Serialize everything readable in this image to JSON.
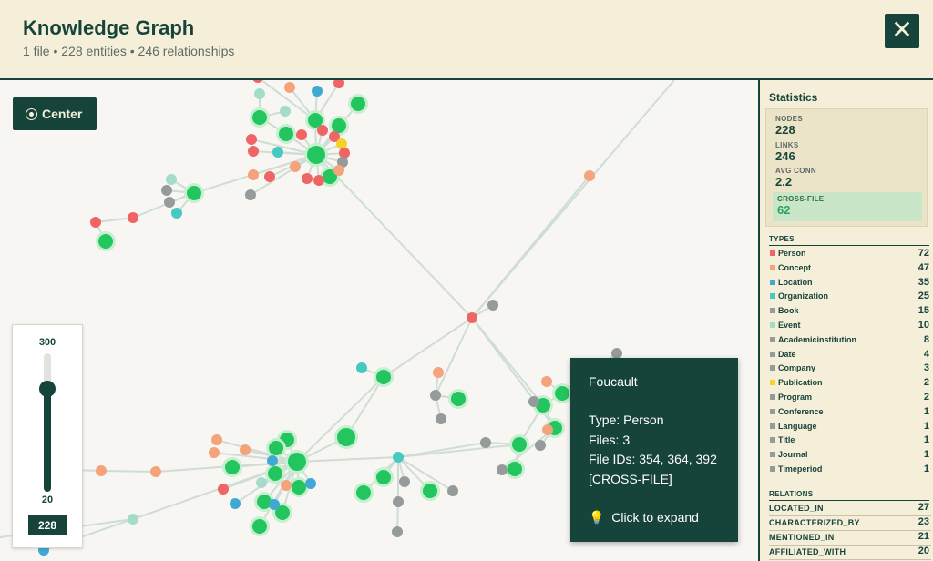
{
  "header": {
    "title": "Knowledge Graph",
    "subtitle": "1 file • 228 entities • 246 relationships",
    "close_icon": "close-icon",
    "close_glyph": "✕"
  },
  "toolbar": {
    "center_label": "Center",
    "center_icon": "target-icon"
  },
  "slider": {
    "max_label": "300",
    "min_label": "20",
    "value": "228",
    "max": 300,
    "min": 20,
    "current": 228
  },
  "tooltip": {
    "name": "Foucault",
    "type_line": "Type: Person",
    "files_line": "Files: 3",
    "ids_line": "File IDs: 354, 364, 392",
    "flag": "[CROSS-FILE]",
    "action_icon": "lightbulb-icon",
    "action_glyph": "💡",
    "action_label": "Click to expand"
  },
  "sidebar": {
    "title": "Statistics",
    "stats": {
      "nodes_label": "NODES",
      "nodes": "228",
      "links_label": "LINKS",
      "links": "246",
      "avg_label": "AVG CONN",
      "avg": "2.2",
      "cross_label": "CROSS-FILE",
      "cross": "62"
    },
    "types_title": "TYPES",
    "types": [
      {
        "name": "Person",
        "count": "72",
        "color": "#ef6565"
      },
      {
        "name": "Concept",
        "count": "47",
        "color": "#f4a37b"
      },
      {
        "name": "Location",
        "count": "35",
        "color": "#3fa9d3"
      },
      {
        "name": "Organization",
        "count": "25",
        "color": "#45c9c2"
      },
      {
        "name": "Book",
        "count": "15",
        "color": "#949b9a"
      },
      {
        "name": "Event",
        "count": "10",
        "color": "#a3dcc8"
      },
      {
        "name": "Academicinstitution",
        "count": "8",
        "color": "#949b9a"
      },
      {
        "name": "Date",
        "count": "4",
        "color": "#949b9a"
      },
      {
        "name": "Company",
        "count": "3",
        "color": "#949b9a"
      },
      {
        "name": "Publication",
        "count": "2",
        "color": "#f5d22b"
      },
      {
        "name": "Program",
        "count": "2",
        "color": "#949b9a"
      },
      {
        "name": "Conference",
        "count": "1",
        "color": "#949b9a"
      },
      {
        "name": "Language",
        "count": "1",
        "color": "#949b9a"
      },
      {
        "name": "Title",
        "count": "1",
        "color": "#949b9a"
      },
      {
        "name": "Journal",
        "count": "1",
        "color": "#949b9a"
      },
      {
        "name": "Timeperiod",
        "count": "1",
        "color": "#949b9a"
      }
    ],
    "relations_title": "RELATIONS",
    "relations": [
      {
        "name": "LOCATED_IN",
        "count": "27"
      },
      {
        "name": "CHARACTERIZED_BY",
        "count": "23"
      },
      {
        "name": "MENTIONED_IN",
        "count": "21"
      },
      {
        "name": "AFFILIATED_WITH",
        "count": "20"
      }
    ]
  },
  "graph": {
    "colors": {
      "person": "#ef6565",
      "concept": "#f4a37b",
      "location": "#3fa9d3",
      "organization": "#45c9c2",
      "gray": "#949b9a",
      "event": "#a3dcc8",
      "publication": "#f5d22b",
      "hub": "#22c55e",
      "halo": "#c6efd0",
      "link": "#cfddd4"
    }
  }
}
